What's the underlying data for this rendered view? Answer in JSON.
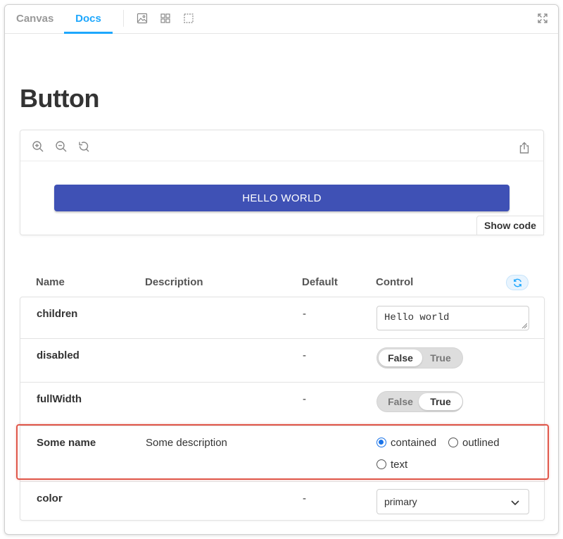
{
  "tabs": [
    {
      "label": "Canvas",
      "active": false
    },
    {
      "label": "Docs",
      "active": true
    }
  ],
  "toolbar_icons": [
    "image-icon",
    "grid-icon",
    "outline-icon",
    "fullscreen-icon"
  ],
  "page": {
    "title": "Button"
  },
  "preview": {
    "zoom_icons": [
      "zoom-in-icon",
      "zoom-out-icon",
      "zoom-reset-icon"
    ],
    "share_icon": "share-icon",
    "button_label": "Hello world",
    "show_code_label": "Show code",
    "button_color": "#3f51b5"
  },
  "args_table": {
    "headers": {
      "name": "Name",
      "description": "Description",
      "default": "Default",
      "control": "Control"
    },
    "reset_icon": "reset-icon",
    "rows": [
      {
        "name": "children",
        "description": "",
        "default": "-",
        "control": {
          "type": "text",
          "value": "Hello world"
        }
      },
      {
        "name": "disabled",
        "description": "",
        "default": "-",
        "control": {
          "type": "boolean",
          "false_label": "False",
          "true_label": "True",
          "value": false
        }
      },
      {
        "name": "fullWidth",
        "description": "",
        "default": "-",
        "control": {
          "type": "boolean",
          "false_label": "False",
          "true_label": "True",
          "value": true
        }
      },
      {
        "name": "Some name",
        "description": "Some description",
        "default": "",
        "control": {
          "type": "radio",
          "options": [
            "contained",
            "outlined",
            "text"
          ],
          "selected": "contained"
        }
      },
      {
        "name": "color",
        "description": "",
        "default": "-",
        "control": {
          "type": "select",
          "value": "primary"
        }
      }
    ]
  },
  "colors": {
    "accent": "#1ea7fd",
    "highlight": "#e0574a",
    "radio_selected": "#1a73e8"
  }
}
